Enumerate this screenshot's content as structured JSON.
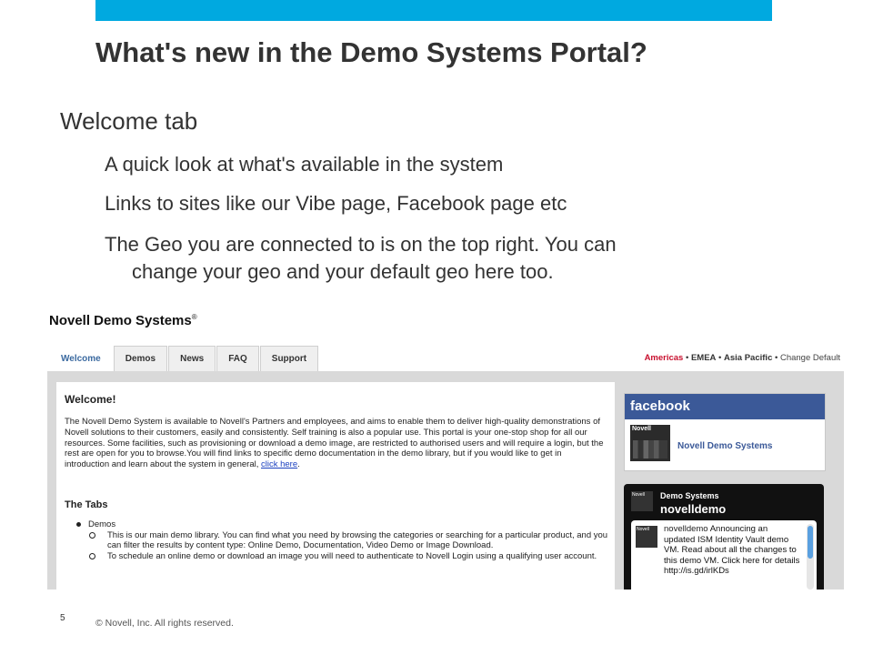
{
  "slide": {
    "title": "What's new in the Demo Systems Portal?",
    "bullet1": "Welcome tab",
    "sub1": "A quick look at what's available in the system",
    "sub2": "Links to sites like our Vibe page, Facebook page etc",
    "sub3_line1": "The Geo you are connected to is on the top right.  You can",
    "sub3_line2": "change your geo and your default geo here too.",
    "page_number": "5",
    "copyright": "© Novell, Inc.  All rights reserved."
  },
  "portal": {
    "logo": "Novell Demo Systems",
    "logo_mark": "®",
    "tabs": [
      "Welcome",
      "Demos",
      "News",
      "FAQ",
      "Support"
    ],
    "geo": {
      "active": "Americas",
      "items": [
        "EMEA",
        "Asia Pacific"
      ],
      "change_default": "Change Default",
      "separator": "•"
    },
    "welcome": {
      "title": "Welcome!",
      "paragraph": "The Novell Demo System is available to Novell's Partners and employees, and aims to enable them to deliver high-quality demonstrations of Novell solutions to their customers, easily and consistently. Self training is also a popular use. This portal is your one-stop shop for all our resources. Some facilities, such as provisioning or download a demo image, are restricted to authorised users and will require a login, but the rest are open for you to browse.You will find links to specific demo documentation in the demo library, but if you would like to get in introduction and learn about the system in general,",
      "link": "click here",
      "link_suffix": "."
    },
    "tabs_section": {
      "title": "The Tabs",
      "item": "Demos",
      "sub_items": [
        "This is our main demo library. You can find what you need by browsing the categories or searching for a particular product, and you can filter the results by content type: Online Demo, Documentation, Video Demo or Image Download.",
        "To schedule an online demo or download an image you will need to authenticate to Novell Login using a qualifying user account."
      ]
    },
    "facebook": {
      "header": "facebook",
      "page_name": "Novell Demo Systems",
      "thumb_caption": "Novell"
    },
    "twitter": {
      "brand": "Demo Systems",
      "handle": "novelldemo",
      "thumb_caption": "Novell",
      "tweet_user": "novelldemo",
      "tweet_text": "Announcing an updated ISM Identity Vault demo VM. Read about all the changes to this demo VM. Click here for details",
      "tweet_link": "http://is.gd/irlKDs"
    }
  },
  "colors": {
    "topbar": "#00a9e0",
    "facebook_blue": "#3b5998",
    "geo_active": "#c8102e"
  }
}
